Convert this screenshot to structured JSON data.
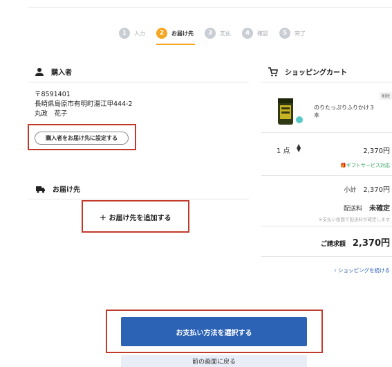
{
  "steps": [
    {
      "num": "1",
      "label": "入力"
    },
    {
      "num": "2",
      "label": "お届け先"
    },
    {
      "num": "3",
      "label": "支払"
    },
    {
      "num": "4",
      "label": "確認"
    },
    {
      "num": "5",
      "label": "完了"
    }
  ],
  "buyer": {
    "title": "購入者",
    "postal": "〒8591401",
    "address": "長崎県島原市有明町湯江甲444-2",
    "name": "丸政　花子",
    "set_button": "購入者をお届け先に設定する"
  },
  "delivery": {
    "title": "お届け先",
    "add_label": "＋ お届け先を追加する"
  },
  "cart": {
    "title": "ショッピングカート",
    "item": {
      "badge": "削除",
      "name": "のりたっぷりふりかけ３本",
      "quantity": "1 点",
      "price": "2,370円",
      "gift": "🎁ギフトサービス対応"
    },
    "subtotal_label": "小計",
    "subtotal_value": "2,370円",
    "shipping_label": "配送料",
    "shipping_value": "未確定",
    "shipping_note": "※支払い画面で配送料が確定します",
    "total_label": "ご請求額",
    "total_value": "2,370円",
    "continue_label": "‹ ショッピングを続ける"
  },
  "actions": {
    "primary": "お支払い方法を選択する",
    "back": "前の画面に戻る"
  },
  "colors": {
    "accent": "#f5a623",
    "primary": "#2c63b5",
    "highlight": "#c0392b",
    "gift": "#2e9e5b"
  }
}
